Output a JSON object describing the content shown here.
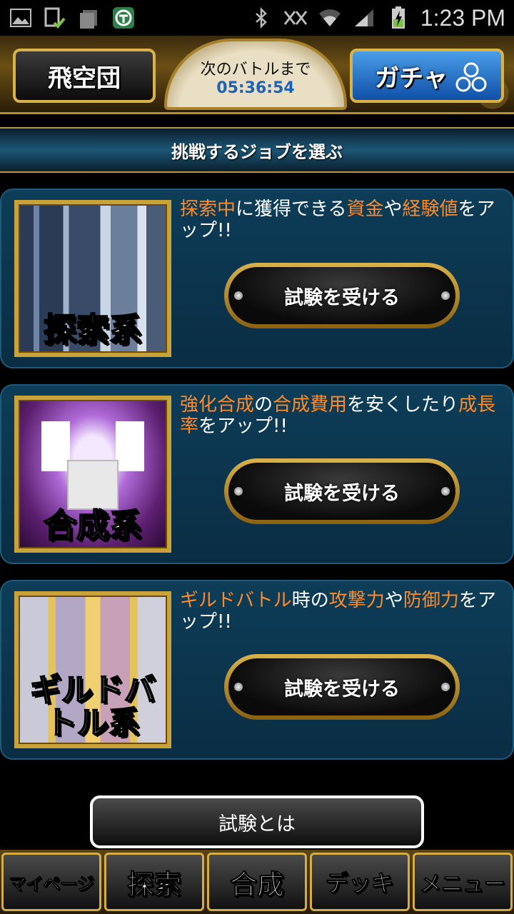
{
  "statusbar": {
    "left_icons": [
      "image-icon",
      "sd-check-icon",
      "storage-icon",
      "shield-icon"
    ],
    "right_icons": [
      "bluetooth-icon",
      "nfc-icon",
      "wifi-icon",
      "signal-icon",
      "battery-charging-icon"
    ],
    "time": "1:23 PM"
  },
  "header": {
    "left_button": "飛空団",
    "right_button": "ガチャ",
    "timer_label": "次のバトルまで",
    "timer_value": "05:36:54"
  },
  "section_title": "挑戦するジョブを選ぶ",
  "jobs": [
    {
      "name": "探索系",
      "desc": [
        {
          "t": "探索中",
          "hl": true
        },
        {
          "t": "に獲得できる",
          "hl": false
        },
        {
          "t": "資金",
          "hl": true
        },
        {
          "t": "や",
          "hl": false
        },
        {
          "t": "経験値",
          "hl": true
        },
        {
          "t": "をアップ!!",
          "hl": false
        }
      ],
      "button": "試験を受ける"
    },
    {
      "name": "合成系",
      "desc": [
        {
          "t": "強化合成",
          "hl": true
        },
        {
          "t": "の",
          "hl": false
        },
        {
          "t": "合成費用",
          "hl": true
        },
        {
          "t": "を安くしたり",
          "hl": false
        },
        {
          "t": "成長率",
          "hl": true
        },
        {
          "t": "をアップ!!",
          "hl": false
        }
      ],
      "button": "試験を受ける"
    },
    {
      "name": "ギルドバトル系",
      "desc": [
        {
          "t": "ギルドバトル",
          "hl": true
        },
        {
          "t": "時の",
          "hl": false
        },
        {
          "t": "攻撃力",
          "hl": true
        },
        {
          "t": "や",
          "hl": false
        },
        {
          "t": "防御力",
          "hl": true
        },
        {
          "t": "をアップ!!",
          "hl": false
        }
      ],
      "button": "試験を受ける"
    }
  ],
  "about_button": "試験とは",
  "nav": [
    "マイページ",
    "探索",
    "合成",
    "デッキ",
    "メニュー"
  ],
  "colors": {
    "highlight": "#ff8a2a",
    "timer": "#1c62b8",
    "gold": "#d9b24a"
  }
}
